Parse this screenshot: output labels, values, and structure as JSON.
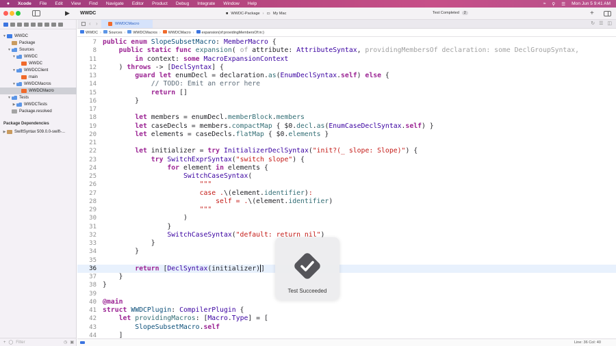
{
  "menubar": {
    "app": "Xcode",
    "items": [
      "File",
      "Edit",
      "View",
      "Find",
      "Navigate",
      "Editor",
      "Product",
      "Debug",
      "Integrate",
      "Window",
      "Help"
    ],
    "datetime": "Mon Jun 5  9:41 AM"
  },
  "toolbar": {
    "project_title": "WWDC",
    "scheme": "WWDC-Package",
    "destination": "My Mac",
    "status": "Test Completed",
    "status_count": "2"
  },
  "navigator": {
    "rows": [
      {
        "label": "WWDC",
        "icon": "proj"
      },
      {
        "label": "Package",
        "icon": "pkg"
      },
      {
        "label": "Sources",
        "icon": "folder"
      },
      {
        "label": "WWDC",
        "icon": "folder"
      },
      {
        "label": "WWDC",
        "icon": "swift"
      },
      {
        "label": "WWDCClient",
        "icon": "folder"
      },
      {
        "label": "main",
        "icon": "swift"
      },
      {
        "label": "WWDCMacros",
        "icon": "folder"
      },
      {
        "label": "WWDCMacro",
        "icon": "swift"
      },
      {
        "label": "Tests",
        "icon": "folder"
      },
      {
        "label": "WWDCTests",
        "icon": "folder"
      },
      {
        "label": "Package.resolved",
        "icon": "file"
      }
    ],
    "deps_header": "Package Dependencies",
    "deps_item": "SwiftSyntax 509.0.0-swift-...",
    "filter_placeholder": "Filter"
  },
  "tabs": {
    "active": "WWDCMacro"
  },
  "jumpbar": [
    "WWDC",
    "Sources",
    "WWDCMacros",
    "WWDCMacro",
    "expansion(of:providingMembersOf:in:)"
  ],
  "editor": {
    "lines": [
      {
        "n": "7",
        "html": "<span class=\"kw\">public enum</span> <span class=\"ty\">SlopeSubsetMacro</span>: <span class=\"tyx\">MemberMacro</span> {",
        "sticky": true
      },
      {
        "n": "8",
        "html": "    <span class=\"kw\">public static func</span> <span class=\"fn\">expansion</span>( <span class=\"dim\">of</span> attribute: <span class=\"tyx\">AttributeSyntax</span>, <span class=\"dim\">providingMembersOf declaration: some DeclGroupSyntax,</span>",
        "sticky": true
      },
      {
        "n": "11",
        "html": "        <span class=\"kw\">in</span> context: <span class=\"kw\">some</span> <span class=\"tyx\">MacroExpansionContext</span>"
      },
      {
        "n": "12",
        "html": "    ) <span class=\"kw\">throws</span> -> [<span class=\"tyx\">DeclSyntax</span>] {"
      },
      {
        "n": "13",
        "html": "        <span class=\"kw\">guard let</span> enumDecl = declaration.<span class=\"fn\">as</span>(<span class=\"tyx\">EnumDeclSyntax</span>.<span class=\"kw\">self</span>) <span class=\"kw\">else</span> {"
      },
      {
        "n": "14",
        "html": "            <span class=\"cm\">// TODO: Emit an error here</span>"
      },
      {
        "n": "15",
        "html": "            <span class=\"kw\">return</span> []"
      },
      {
        "n": "16",
        "html": "        }"
      },
      {
        "n": "17",
        "html": ""
      },
      {
        "n": "18",
        "html": "        <span class=\"kw\">let</span> members = enumDecl.<span class=\"fn\">memberBlock</span>.<span class=\"fn\">members</span>"
      },
      {
        "n": "19",
        "html": "        <span class=\"kw\">let</span> caseDecls = members.<span class=\"fn\">compactMap</span> { $0.<span class=\"fn\">decl</span>.<span class=\"fn\">as</span>(<span class=\"tyx\">EnumCaseDeclSyntax</span>.<span class=\"kw\">self</span>) }"
      },
      {
        "n": "20",
        "html": "        <span class=\"kw\">let</span> elements = caseDecls.<span class=\"fn\">flatMap</span> { $0.<span class=\"fn\">elements</span> }"
      },
      {
        "n": "21",
        "html": ""
      },
      {
        "n": "22",
        "html": "        <span class=\"kw\">let</span> initializer = <span class=\"kw\">try</span> <span class=\"tyx\">InitializerDeclSyntax</span>(<span class=\"str\">\"init?(_ slope: Slope)\"</span>) {"
      },
      {
        "n": "23",
        "html": "            <span class=\"kw\">try</span> <span class=\"tyx\">SwitchExprSyntax</span>(<span class=\"str\">\"switch slope\"</span>) {"
      },
      {
        "n": "24",
        "html": "                <span class=\"kw\">for</span> element <span class=\"kw\">in</span> elements {"
      },
      {
        "n": "25",
        "html": "                    <span class=\"tyx\">SwitchCaseSyntax</span>("
      },
      {
        "n": "26",
        "html": "                        <span class=\"str\">\"\"\"</span>"
      },
      {
        "n": "27",
        "html": "                        <span class=\"str\">case .</span>\\(element.<span class=\"fn\">identifier</span>)<span class=\"str\">:</span>"
      },
      {
        "n": "28",
        "html": "                            <span class=\"str\">self = .</span>\\(element.<span class=\"fn\">identifier</span>)"
      },
      {
        "n": "29",
        "html": "                        <span class=\"str\">\"\"\"</span>"
      },
      {
        "n": "30",
        "html": "                    )"
      },
      {
        "n": "31",
        "html": "                }"
      },
      {
        "n": "32",
        "html": "                <span class=\"tyx\">SwitchCaseSyntax</span>(<span class=\"str\">\"default: return nil\"</span>)"
      },
      {
        "n": "33",
        "html": "            }"
      },
      {
        "n": "34",
        "html": "        }"
      },
      {
        "n": "35",
        "html": ""
      },
      {
        "n": "36",
        "html": "        <span class=\"kw\">return</span> [<span class=\"tyx\">DeclSyntax</span>(initializer)<span class=\"cursor\"></span>]",
        "hl": true
      },
      {
        "n": "37",
        "html": "    }"
      },
      {
        "n": "38",
        "html": "}"
      },
      {
        "n": "39",
        "html": ""
      },
      {
        "n": "40",
        "html": "<span class=\"kw\">@main</span>"
      },
      {
        "n": "41",
        "html": "<span class=\"kw\">struct</span> <span class=\"ty\">WWDCPlugin</span>: <span class=\"tyx\">CompilerPlugin</span> {"
      },
      {
        "n": "42",
        "html": "    <span class=\"kw\">let</span> <span class=\"fn\">providingMacros</span>: [<span class=\"tyx\">Macro</span>.<span class=\"tyx\">Type</span>] = ["
      },
      {
        "n": "43",
        "html": "        <span class=\"ty\">SlopeSubsetMacro</span>.<span class=\"kw\">self</span>"
      },
      {
        "n": "44",
        "html": "    ]"
      }
    ]
  },
  "statusbar": {
    "position": "Line: 36  Col: 40"
  },
  "hud": {
    "text": "Test Succeeded"
  },
  "colors": {
    "accent": "#3b74e0",
    "menubar": "#b6467f",
    "swift_icon": "#f06a2b"
  }
}
